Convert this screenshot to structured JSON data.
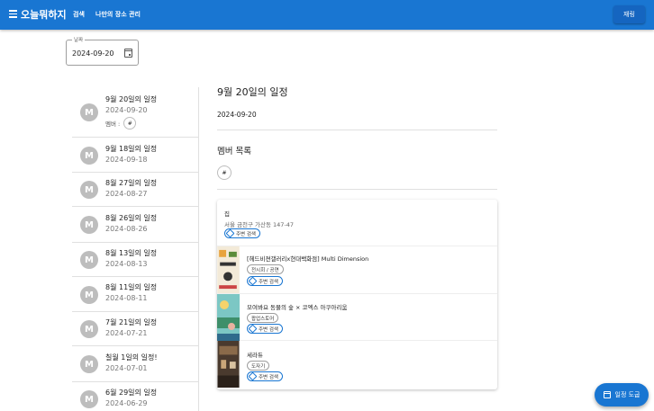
{
  "appbar": {
    "title": "오늘뭐하지",
    "nav": [
      "검색",
      "나만의 장소 관리"
    ],
    "share_label": "재링"
  },
  "date_field": {
    "label": "날짜",
    "value": "2024-09-20"
  },
  "schedules": [
    {
      "avatar": "M",
      "title": "9월 20일의 일정",
      "date": "2024-09-20",
      "member_label": "멤버 :",
      "member": "#"
    },
    {
      "avatar": "M",
      "title": "9월 18일의 일정",
      "date": "2024-09-18"
    },
    {
      "avatar": "M",
      "title": "8월 27일의 일정",
      "date": "2024-08-27"
    },
    {
      "avatar": "M",
      "title": "8월 26일의 일정",
      "date": "2024-08-26"
    },
    {
      "avatar": "M",
      "title": "8월 13일의 일정",
      "date": "2024-08-13"
    },
    {
      "avatar": "M",
      "title": "8월 11일의 일정",
      "date": "2024-08-11"
    },
    {
      "avatar": "M",
      "title": "7월 21일의 일정",
      "date": "2024-07-21"
    },
    {
      "avatar": "M",
      "title": "칠월 1일의 일정!",
      "date": "2024-07-01"
    },
    {
      "avatar": "M",
      "title": "6월 29일의 일정",
      "date": "2024-06-29"
    }
  ],
  "detail": {
    "title": "9월 20일의 일정",
    "date": "2024-09-20",
    "member_heading": "멤버 목록",
    "member": "#"
  },
  "places": [
    {
      "name": "집",
      "address": "서울 금천구 가산동 147-47",
      "category": "",
      "search_label": "주변 검색"
    },
    {
      "name": "[헤드비젼갤러리x현대백화점] Multi Dimension",
      "category": "전시회 / 공연",
      "search_label": "주변 검색"
    },
    {
      "name": "모여봐요 동물의 숲 × 코엑스 아쿠아리움",
      "category": "팝업스토어",
      "search_label": "주변 검색"
    },
    {
      "name": "세라듀",
      "category": "도자기",
      "search_label": "주변 검색"
    }
  ],
  "fab_label": "일정 도굽",
  "colors": {
    "primary": "#1976d2",
    "avatar": "#bdbdbd"
  }
}
